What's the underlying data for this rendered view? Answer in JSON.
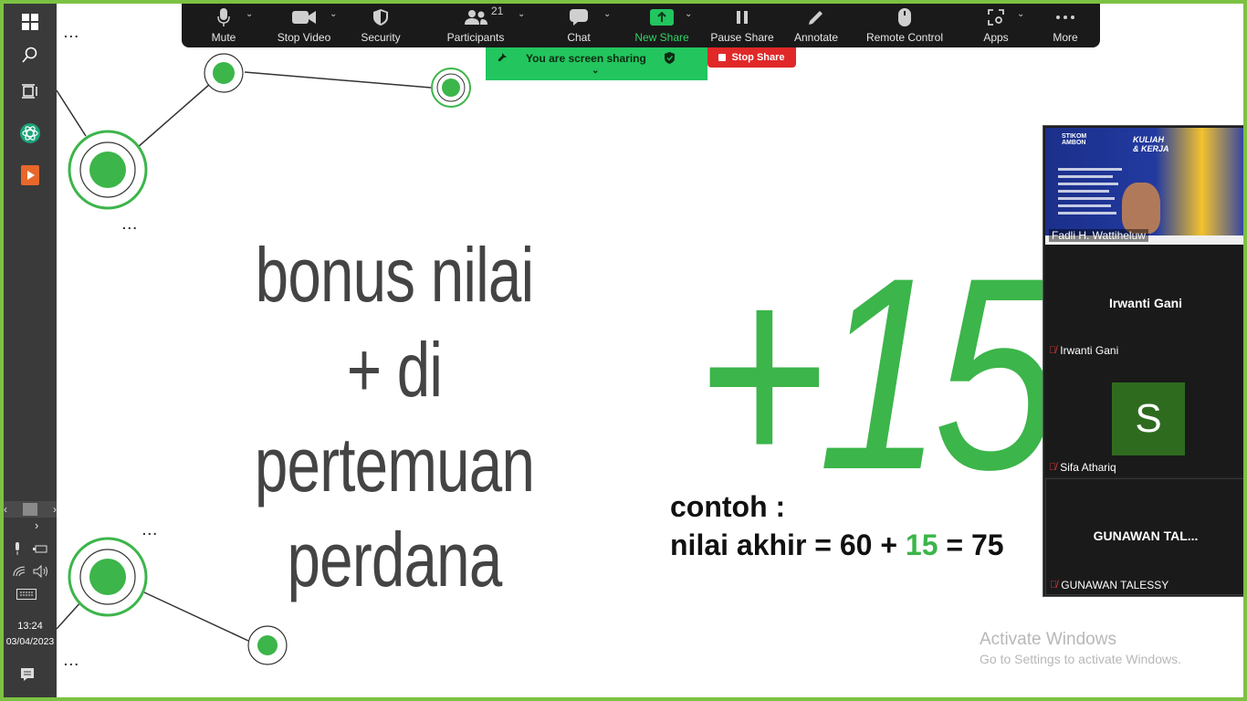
{
  "zoom_toolbar": {
    "mute_label": "Mute",
    "stop_video_label": "Stop Video",
    "security_label": "Security",
    "participants_label": "Participants",
    "participants_count": "21",
    "chat_label": "Chat",
    "new_share_label": "New Share",
    "pause_share_label": "Pause Share",
    "annotate_label": "Annotate",
    "remote_control_label": "Remote Control",
    "apps_label": "Apps",
    "more_label": "More",
    "accent_color": "#2fd563"
  },
  "share_banner": {
    "text": "You are screen sharing",
    "stop_label": "Stop Share",
    "banner_color": "#22c55e",
    "stop_color": "#e02828"
  },
  "slide": {
    "heading_lines": [
      "bonus nilai + di",
      "pertemuan",
      "perdana"
    ],
    "big_number": "+15",
    "example_line1": "contoh :",
    "example_prefix": "nilai akhir = 60 + ",
    "example_bonus": "15",
    "example_suffix": " = 75",
    "accent_color": "#3cb54a",
    "ellipsis": "..."
  },
  "participants": [
    {
      "name": "Fadli H. Wattiheluw",
      "type": "video"
    },
    {
      "name": "Irwanti Gani",
      "center_label": "Irwanti Gani",
      "type": "name",
      "muted": true
    },
    {
      "name": "Sifa Athariq",
      "avatar_letter": "S",
      "type": "avatar",
      "muted": true
    },
    {
      "name": "GUNAWAN TALESSY",
      "center_label": "GUNAWAN TAL...",
      "type": "name",
      "muted": true
    }
  ],
  "taskbar": {
    "time": "13:24",
    "date": "03/04/2023"
  },
  "watermark": {
    "title": "Activate Windows",
    "subtitle": "Go to Settings to activate Windows."
  }
}
